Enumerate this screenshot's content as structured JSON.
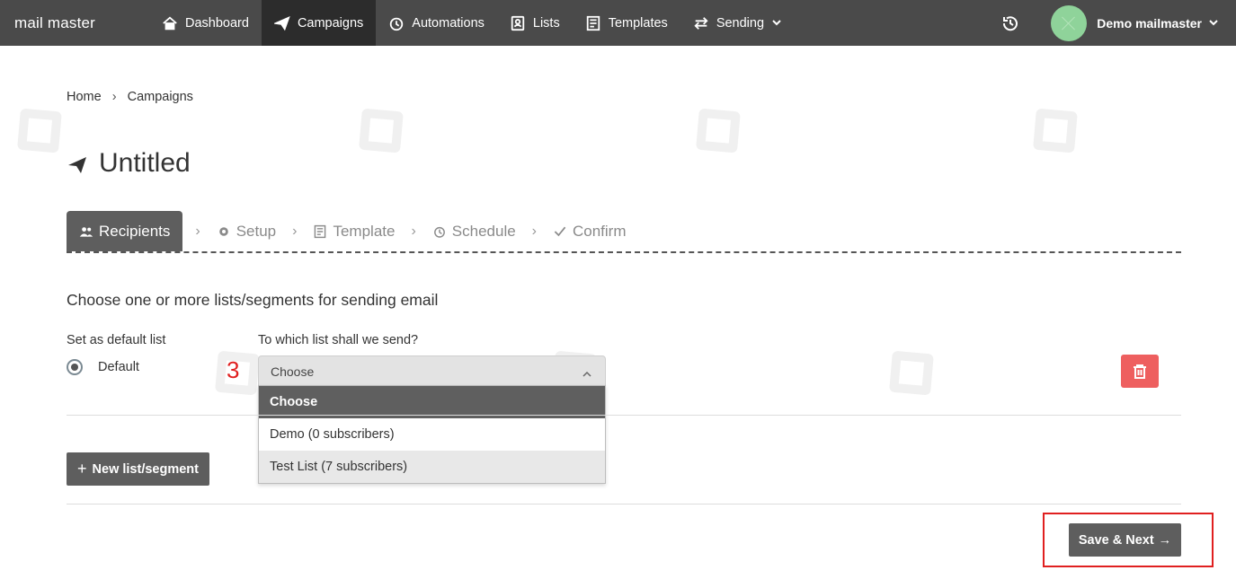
{
  "brand": "mail master",
  "nav": {
    "items": [
      {
        "label": "Dashboard",
        "icon": "home-icon"
      },
      {
        "label": "Campaigns",
        "icon": "paper-plane-icon",
        "active": true
      },
      {
        "label": "Automations",
        "icon": "alarm-clock-icon"
      },
      {
        "label": "Lists",
        "icon": "address-book-icon"
      },
      {
        "label": "Templates",
        "icon": "template-icon"
      },
      {
        "label": "Sending",
        "icon": "arrows-exchange-icon",
        "dropdown": true
      }
    ],
    "user": "Demo mailmaster",
    "history_icon": "history-icon"
  },
  "breadcrumb": {
    "home": "Home",
    "sep": "›",
    "current": "Campaigns"
  },
  "page_title": "Untitled",
  "steps": [
    {
      "label": "Recipients",
      "active": true
    },
    {
      "label": "Setup"
    },
    {
      "label": "Template"
    },
    {
      "label": "Schedule"
    },
    {
      "label": "Confirm"
    }
  ],
  "step_sep": "›",
  "section_title": "Choose one or more lists/segments for sending email",
  "default_list": {
    "label": "Set as default list",
    "radio_label": "Default"
  },
  "annotation_number": "3",
  "list_select": {
    "label": "To which list shall we send?",
    "value": "Choose",
    "options": [
      "Choose",
      "Demo (0 subscribers)",
      "Test List (7 subscribers)"
    ]
  },
  "buttons": {
    "new_list": "New list/segment",
    "new_list_plus": "+",
    "save_next": "Save & Next",
    "save_arrow": "→"
  },
  "colors": {
    "nav_bg": "#4a4a4a",
    "active_tab": "#5e5e5e",
    "danger": "#ee5f5f",
    "highlight": "#e02020"
  }
}
